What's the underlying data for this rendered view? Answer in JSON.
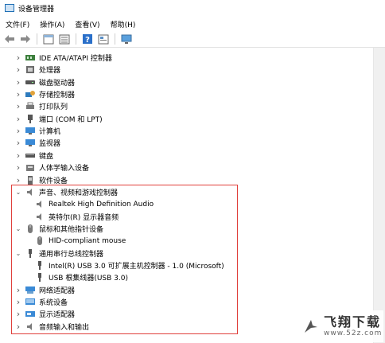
{
  "window": {
    "title": "设备管理器"
  },
  "menu": [
    "文件(F)",
    "操作(A)",
    "查看(V)",
    "帮助(H)"
  ],
  "toolbar": [
    "back-arrow-icon",
    "forward-arrow-icon",
    "properties-panel-icon",
    "list-view-icon",
    "help-icon",
    "device-view-icon",
    "monitor-scan-icon"
  ],
  "tree": [
    {
      "label": "IDE ATA/ATAPI 控制器",
      "icon": "ide-controller-icon",
      "expanded": false
    },
    {
      "label": "处理器",
      "icon": "processor-icon",
      "expanded": false
    },
    {
      "label": "磁盘驱动器",
      "icon": "disk-drive-icon",
      "expanded": false
    },
    {
      "label": "存储控制器",
      "icon": "storage-controller-icon",
      "expanded": false
    },
    {
      "label": "打印队列",
      "icon": "printer-icon",
      "expanded": false
    },
    {
      "label": "端口 (COM 和 LPT)",
      "icon": "port-icon",
      "expanded": false
    },
    {
      "label": "计算机",
      "icon": "computer-icon",
      "expanded": false
    },
    {
      "label": "监视器",
      "icon": "monitor-icon",
      "expanded": false
    },
    {
      "label": "键盘",
      "icon": "keyboard-icon",
      "expanded": false
    },
    {
      "label": "人体学输入设备",
      "icon": "hid-icon",
      "expanded": false
    },
    {
      "label": "软件设备",
      "icon": "software-device-icon",
      "expanded": false
    },
    {
      "label": "声音、视频和游戏控制器",
      "icon": "speaker-icon",
      "expanded": true,
      "children": [
        {
          "label": "Realtek High Definition Audio",
          "icon": "speaker-icon"
        },
        {
          "label": "英特尔(R) 显示器音频",
          "icon": "speaker-icon"
        }
      ]
    },
    {
      "label": "鼠标和其他指针设备",
      "icon": "mouse-icon",
      "expanded": true,
      "children": [
        {
          "label": "HID-compliant mouse",
          "icon": "mouse-icon"
        }
      ]
    },
    {
      "label": "通用串行总线控制器",
      "icon": "usb-icon",
      "expanded": true,
      "children": [
        {
          "label": "Intel(R) USB 3.0 可扩展主机控制器 - 1.0 (Microsoft)",
          "icon": "usb-icon"
        },
        {
          "label": "USB 根集线器(USB 3.0)",
          "icon": "usb-icon"
        }
      ]
    },
    {
      "label": "网络适配器",
      "icon": "network-adapter-icon",
      "expanded": false
    },
    {
      "label": "系统设备",
      "icon": "system-device-icon",
      "expanded": false
    },
    {
      "label": "显示适配器",
      "icon": "display-adapter-icon",
      "expanded": false
    },
    {
      "label": "音频输入和输出",
      "icon": "speaker-icon",
      "expanded": false
    }
  ],
  "watermark": {
    "main": "飞翔下载",
    "url": "www.52z.com"
  },
  "colors": {
    "highlight": "#e0403c",
    "accent": "#1f6fb5"
  }
}
